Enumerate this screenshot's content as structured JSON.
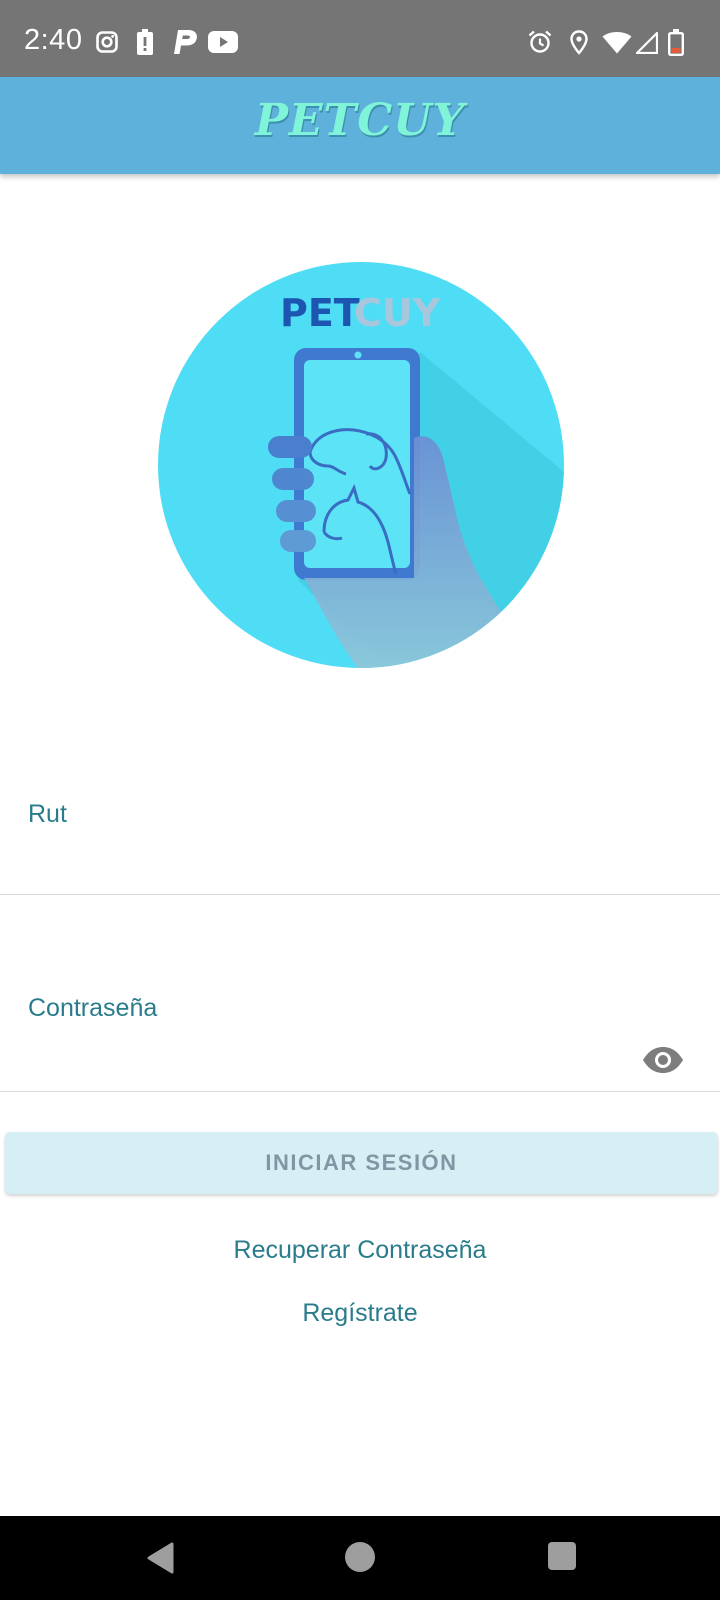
{
  "status_bar": {
    "time": "2:40",
    "left_icons": [
      "instagram-icon",
      "battery-alert-icon",
      "parking-icon",
      "youtube-icon"
    ],
    "right_icons": [
      "alarm-icon",
      "location-icon",
      "wifi-icon",
      "signal-icon",
      "battery-icon"
    ]
  },
  "app_bar": {
    "title": "PETCUY",
    "title_color": "#7ff4d8",
    "background": "#5eb1da"
  },
  "logo": {
    "wordmark_part1": "PET",
    "wordmark_part2": "CUY",
    "circle_color": "#4fdcf5"
  },
  "form": {
    "rut_label": "Rut",
    "rut_value": "",
    "password_label": "Contraseña",
    "password_value": "",
    "login_button": "INICIAR SESIÓN",
    "recover_link": "Recuperar Contraseña",
    "register_link": "Regístrate",
    "label_color": "#2a7c8c"
  },
  "nav_bar": {
    "buttons": [
      "back-icon",
      "home-icon",
      "recents-icon"
    ]
  }
}
